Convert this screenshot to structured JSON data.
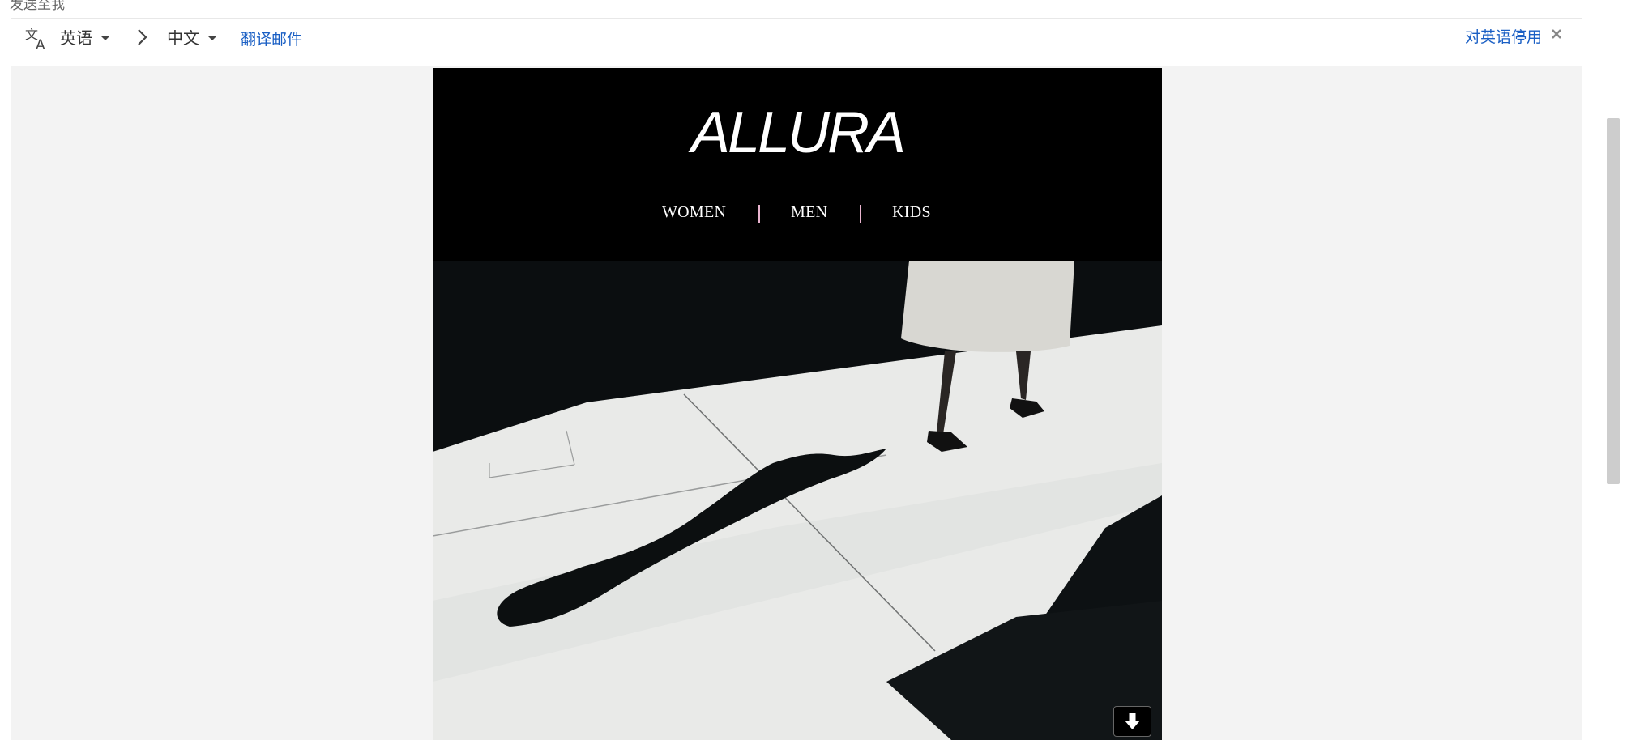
{
  "header": {
    "cut_off_text": "发送至我"
  },
  "translation_bar": {
    "source_language": "英语",
    "target_language": "中文",
    "translate_link": "翻译邮件",
    "disable_link": "对英语停用",
    "icons": [
      "translate-icon",
      "chevron-right-icon",
      "caret-down-icon",
      "close-icon"
    ]
  },
  "email": {
    "logo_text": "ALLURA",
    "nav": [
      "WOMEN",
      "MEN",
      "KIDS"
    ],
    "hero_description": null,
    "colors": {
      "header_bg": "#000000",
      "nav_separator": "#e9b4cf",
      "link": "#1a5fc4",
      "content_bg": "#f3f3f3"
    }
  }
}
